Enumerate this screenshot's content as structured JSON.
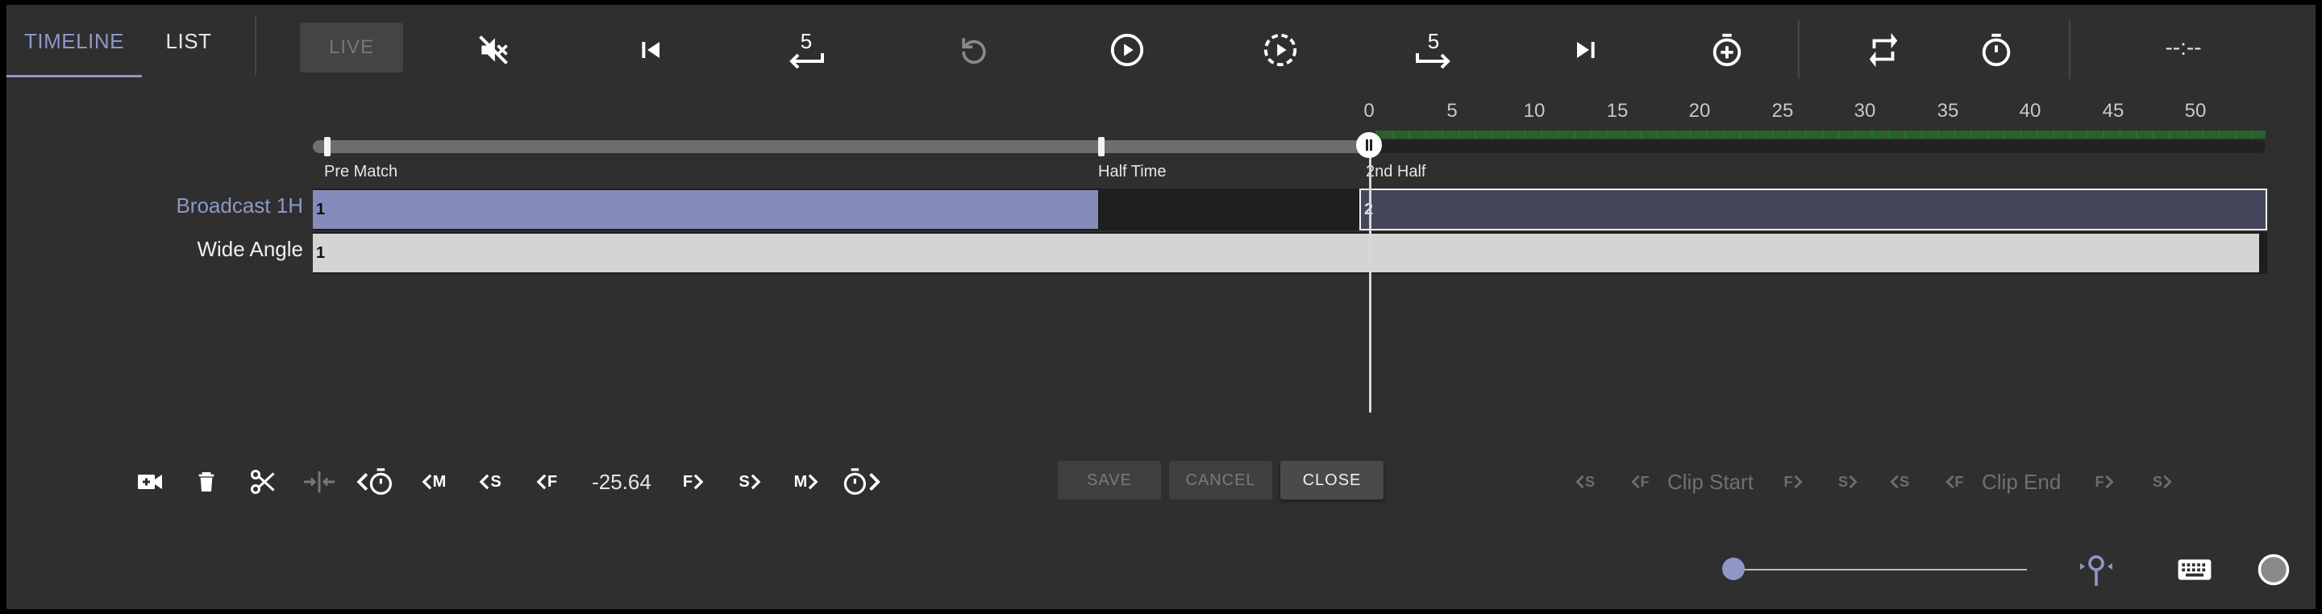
{
  "tabs": [
    {
      "label": "TIMELINE",
      "active": true
    },
    {
      "label": "LIST",
      "active": false
    }
  ],
  "toolbar": {
    "live_label": "LIVE",
    "skip_back_amount": "5",
    "skip_forward_amount": "5",
    "clock_display": "--:--"
  },
  "icons": {
    "mute": "volume-off-icon",
    "start": "skip-to-start-icon",
    "back": "rewind-5-icon",
    "replay": "replay-icon",
    "play": "play-circle-icon",
    "play_slow": "slow-play-icon",
    "forward": "forward-5-icon",
    "end": "skip-to-end-icon",
    "add_timer": "timer-add-icon",
    "loop": "repeat-icon",
    "timer": "stopwatch-icon"
  },
  "ruler": {
    "ticks": [
      "0",
      "5",
      "10",
      "15",
      "20",
      "25",
      "30",
      "35",
      "40",
      "45",
      "50"
    ]
  },
  "markers": [
    {
      "label": "Pre Match"
    },
    {
      "label": "Half Time"
    },
    {
      "label": "2nd Half"
    }
  ],
  "tracks": [
    {
      "label": "Broadcast 1H",
      "active": true,
      "segments": [
        {
          "label": "1"
        },
        {
          "label": "2"
        }
      ]
    },
    {
      "label": "Wide Angle",
      "active": false,
      "segments": [
        {
          "label": "1"
        }
      ]
    }
  ],
  "edit": {
    "offset_value": "-25.64",
    "save_label": "SAVE",
    "cancel_label": "CANCEL",
    "close_label": "CLOSE",
    "step_labels": {
      "m": "M",
      "s": "S",
      "f": "F"
    }
  },
  "clip": {
    "start_label": "Clip Start",
    "end_label": "Clip End"
  },
  "zoom": {
    "level": 0.0
  },
  "colors": {
    "accent": "#8e97c8",
    "panel": "#2f2f2f",
    "segment_active": "#848cbb",
    "segment_dark": "#444659",
    "segment_light": "#d4d4d4",
    "ruler_green": "#1f7a1f"
  }
}
